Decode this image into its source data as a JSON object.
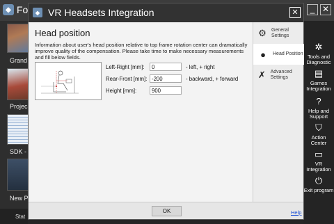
{
  "background_app": {
    "title_fragment": "Fo",
    "thumbnails": [
      {
        "label": "Grand"
      },
      {
        "label": "Projec"
      },
      {
        "label": "SDK -"
      },
      {
        "label": "New Pr"
      }
    ],
    "status_label": "Stat",
    "window_buttons": [
      "_",
      "✕"
    ]
  },
  "right_panel": {
    "items": [
      {
        "label": "Tools and Diagnostic",
        "icon": "tools-icon"
      },
      {
        "label": "Games Integration",
        "icon": "games-icon"
      },
      {
        "label": "Help and Support",
        "icon": "help-icon"
      },
      {
        "label": "Action Center",
        "icon": "action-center-icon"
      },
      {
        "label": "VR Integration",
        "icon": "vr-headset-icon"
      },
      {
        "label": "Exit program",
        "icon": "power-icon"
      }
    ]
  },
  "dialog": {
    "title": "VR Headsets Integration",
    "close_glyph": "✕",
    "heading": "Head position",
    "description": "Information about user's head position relative to top frame rotation center can dramatically improve quality of the compensation. Please take time to make necessary measurements and fill below fields.",
    "fields": [
      {
        "label": "Left-Right [mm]:",
        "value": "0",
        "hint": "- left, + right"
      },
      {
        "label": "Rear-Front [mm]:",
        "value": "-200",
        "hint": "- backward, + forward"
      },
      {
        "label": "Height [mm]:",
        "value": "900",
        "hint": ""
      }
    ],
    "side_nav": [
      {
        "label": "General Settings",
        "icon": "gears-icon",
        "active": false
      },
      {
        "label": "Head Position",
        "icon": "helmet-icon",
        "active": true
      },
      {
        "label": "Advanced Settings",
        "icon": "wrench-icon",
        "active": false
      }
    ],
    "ok_label": "OK",
    "help_label": "Help"
  },
  "colors": {
    "accent": "#6d8fb3",
    "link": "#1a4fd6"
  }
}
